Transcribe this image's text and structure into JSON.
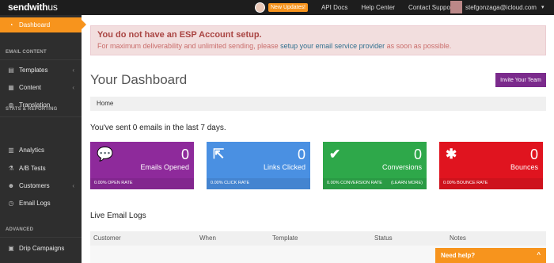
{
  "topbar": {
    "logo_bold": "sendwith",
    "logo_regular": "us",
    "new_updates": "New Updates!",
    "api_docs": "API Docs",
    "help_center": "Help Center",
    "contact_support": "Contact Support",
    "user_email": "stefgonzaga@icloud.com",
    "user_caret": "▾"
  },
  "sidebar": {
    "active_item": "Dashboard",
    "sections": {
      "email_content": "EMAIL CONTENT",
      "stats_reporting": "STATS & REPORTING",
      "advanced": "ADVANCED"
    },
    "items": {
      "templates": "Templates",
      "content": "Content",
      "translation": "Translation",
      "analytics": "Analytics",
      "ab_tests": "A/B Tests",
      "customers": "Customers",
      "email_logs": "Email Logs",
      "drip_campaigns": "Drip Campaigns"
    },
    "arrow": "‹"
  },
  "alert": {
    "title": "You do not have an ESP Account setup.",
    "text_before": "For maximum deliverability and unlimited sending, please ",
    "link": "setup your email service provider",
    "text_after": " as soon as possible."
  },
  "main": {
    "title": "Your Dashboard",
    "invite_button": "Invite Your Team",
    "breadcrumb": "Home",
    "sent_line": "You've sent 0 emails in the last 7 days."
  },
  "cards": [
    {
      "label": "Emails Opened",
      "value": "0",
      "foot": "0.00% OPEN RATE",
      "foot_right": "",
      "color": "#8e2a9b"
    },
    {
      "label": "Links Clicked",
      "value": "0",
      "foot": "0.00% CLICK RATE",
      "foot_right": "",
      "color": "#4a90e2"
    },
    {
      "label": "Conversions",
      "value": "0",
      "foot": "0.00% CONVERSION RATE",
      "foot_right": "(LEARN MORE)",
      "color": "#2ea84a"
    },
    {
      "label": "Bounces",
      "value": "0",
      "foot": "0.00% BOUNCE RATE",
      "foot_right": "",
      "color": "#e0141f"
    }
  ],
  "logs": {
    "title": "Live Email Logs",
    "columns": [
      "Customer",
      "When",
      "Template",
      "Status",
      "Notes"
    ]
  },
  "help": {
    "label": "Need help?",
    "icon": "^"
  },
  "colors": {
    "accent": "#f7941d",
    "sidebar_bg": "#2e2e2e",
    "topbar_bg": "#1d1d1d",
    "invite_bg": "#7b2b8c"
  },
  "icons": {
    "dashboard": "dashboard-icon",
    "templates": "templates-icon",
    "content": "content-icon",
    "translation": "globe-icon",
    "analytics": "bar-chart-icon",
    "ab_tests": "flask-icon",
    "customers": "users-icon",
    "email_logs": "clock-icon",
    "drip_campaigns": "drip-icon"
  }
}
